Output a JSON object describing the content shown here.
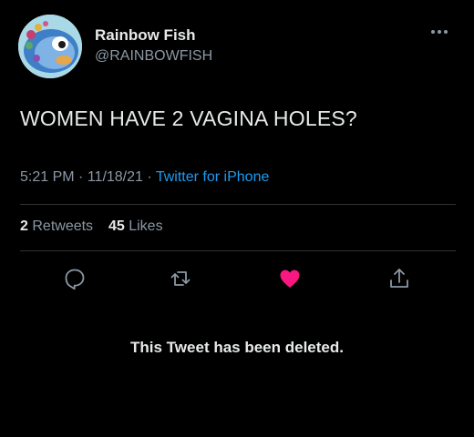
{
  "user": {
    "display_name": "Rainbow Fish",
    "handle": "@RAINBOWFISH",
    "avatar_icon": "rainbow-fish-avatar"
  },
  "tweet": {
    "text": "WOMEN HAVE 2 VAGINA HOLES?",
    "time": "5:21 PM",
    "date": "11/18/21",
    "separator": "·",
    "source": "Twitter for iPhone"
  },
  "stats": {
    "retweets_count": "2",
    "retweets_label": "Retweets",
    "likes_count": "45",
    "likes_label": "Likes"
  },
  "actions": {
    "icons": [
      "reply-icon",
      "retweet-icon",
      "like-icon",
      "share-icon"
    ],
    "like_color": "#f91880"
  },
  "notice": "This Tweet has been deleted.",
  "colors": {
    "background": "#000000",
    "primary_text": "#e7e9ea",
    "secondary_text": "#8b98a5",
    "link": "#1d9bf0",
    "divider": "#2f3336"
  }
}
